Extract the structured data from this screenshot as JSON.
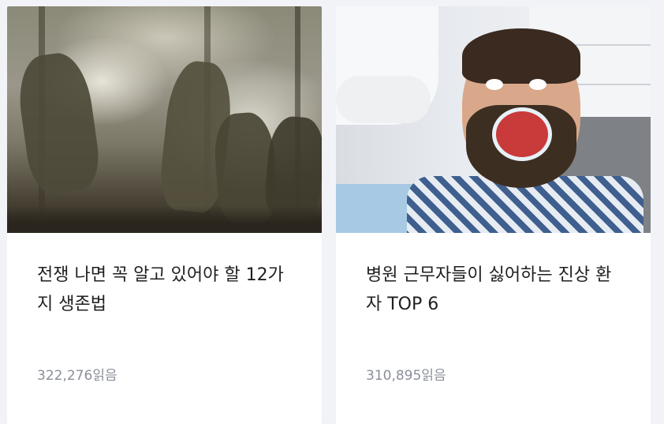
{
  "cards": [
    {
      "title": "전쟁 나면 꼭 알고 있어야 할 12가지 생존법",
      "views": "322,276",
      "views_unit": "읽음",
      "thumbnail": "battlefield-photo"
    },
    {
      "title": "병원 근무자들이 싫어하는 진상 환자 TOP 6",
      "views": "310,895",
      "views_unit": "읽음",
      "thumbnail": "dental-patient-photo"
    }
  ]
}
